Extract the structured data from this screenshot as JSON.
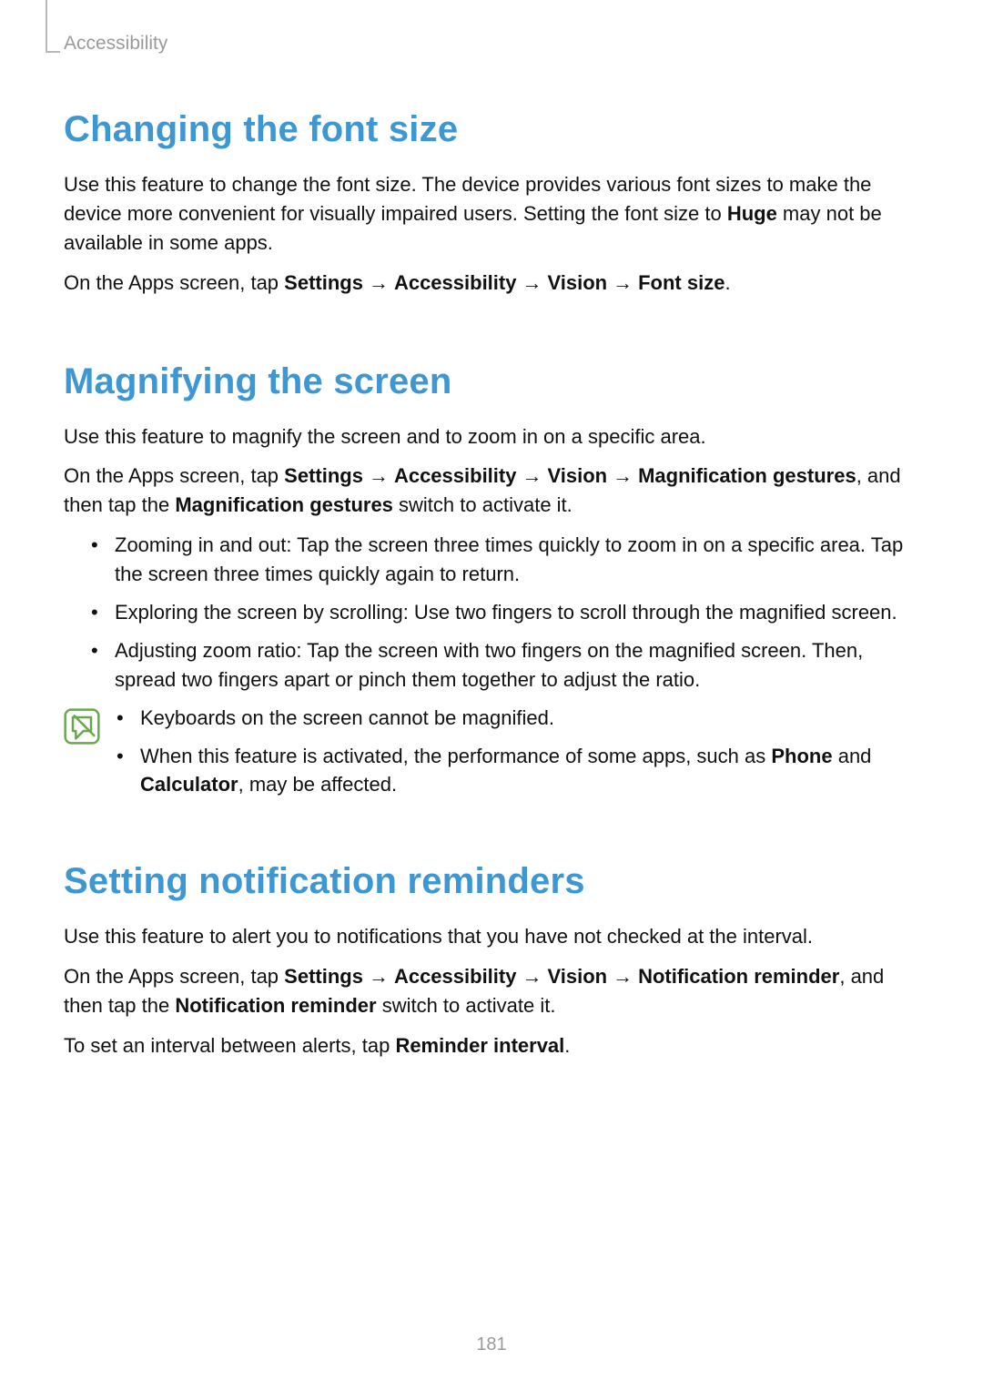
{
  "breadcrumb": "Accessibility",
  "page_number": "181",
  "arrow": "→",
  "sections": {
    "font": {
      "heading": "Changing the font size",
      "p1_a": "Use this feature to change the font size. The device provides various font sizes to make the device more convenient for visually impaired users. Setting the font size to ",
      "p1_bold": "Huge",
      "p1_b": " may not be available in some apps.",
      "p2_a": "On the Apps screen, tap ",
      "path1": "Settings",
      "path2": "Accessibility",
      "path3": "Vision",
      "path4": "Font size",
      "p2_b": "."
    },
    "magnify": {
      "heading": "Magnifying the screen",
      "p1": "Use this feature to magnify the screen and to zoom in on a specific area.",
      "p2_a": "On the Apps screen, tap ",
      "path1": "Settings",
      "path2": "Accessibility",
      "path3": "Vision",
      "path4": "Magnification gestures",
      "p2_b": ", and then tap the ",
      "p2_bold": "Magnification gestures",
      "p2_c": " switch to activate it.",
      "bullets": {
        "b1": "Zooming in and out: Tap the screen three times quickly to zoom in on a specific area. Tap the screen three times quickly again to return.",
        "b2": "Exploring the screen by scrolling: Use two fingers to scroll through the magnified screen.",
        "b3": "Adjusting zoom ratio: Tap the screen with two fingers on the magnified screen. Then, spread two fingers apart or pinch them together to adjust the ratio."
      },
      "note": {
        "n1": "Keyboards on the screen cannot be magnified.",
        "n2_a": "When this feature is activated, the performance of some apps, such as ",
        "n2_bold1": "Phone",
        "n2_mid": " and ",
        "n2_bold2": "Calculator",
        "n2_b": ", may be affected."
      }
    },
    "reminders": {
      "heading": "Setting notification reminders",
      "p1": "Use this feature to alert you to notifications that you have not checked at the interval.",
      "p2_a": "On the Apps screen, tap ",
      "path1": "Settings",
      "path2": "Accessibility",
      "path3": "Vision",
      "path4": "Notification reminder",
      "p2_b": ", and then tap the ",
      "p2_bold": "Notification reminder",
      "p2_c": " switch to activate it.",
      "p3_a": "To set an interval between alerts, tap ",
      "p3_bold": "Reminder interval",
      "p3_b": "."
    }
  }
}
